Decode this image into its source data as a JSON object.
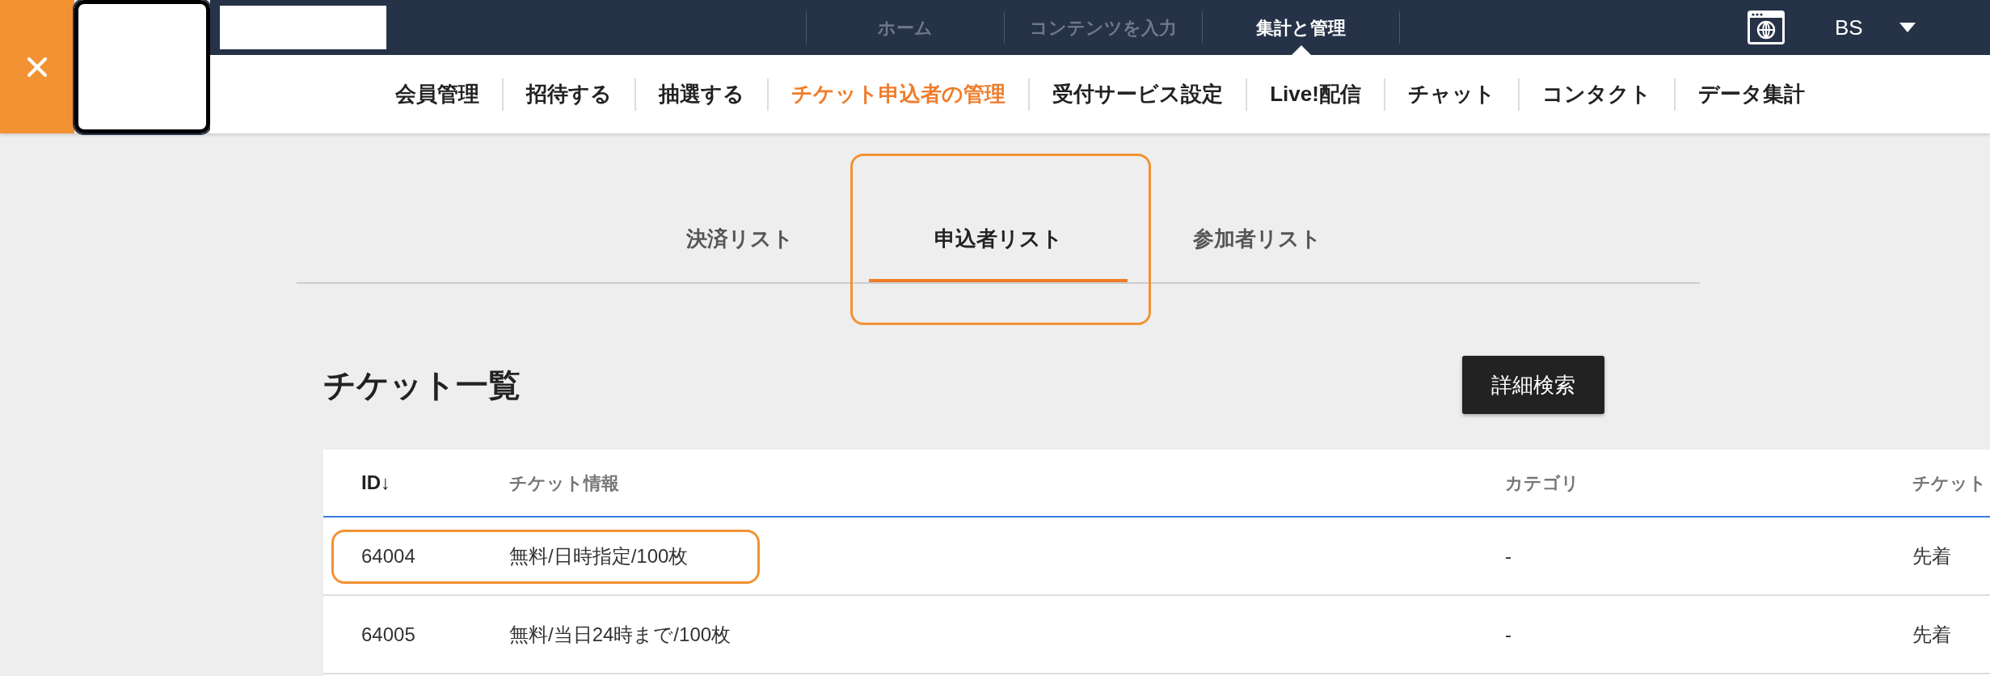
{
  "top_nav": {
    "items": [
      {
        "label": "ホーム",
        "selected": false
      },
      {
        "label": "コンテンツを入力",
        "selected": false
      },
      {
        "label": "集計と管理",
        "selected": true
      }
    ]
  },
  "user": {
    "initials": "BS"
  },
  "main_nav": {
    "items": [
      {
        "label": "会員管理",
        "selected": false
      },
      {
        "label": "招待する",
        "selected": false
      },
      {
        "label": "抽選する",
        "selected": false
      },
      {
        "label": "チケット申込者の管理",
        "selected": true
      },
      {
        "label": "受付サービス設定",
        "selected": false
      },
      {
        "label": "Live!配信",
        "selected": false
      },
      {
        "label": "チャット",
        "selected": false
      },
      {
        "label": "コンタクト",
        "selected": false
      },
      {
        "label": "データ集計",
        "selected": false
      }
    ]
  },
  "tabs": [
    {
      "label": "決済リスト",
      "selected": false,
      "highlighted": false
    },
    {
      "label": "申込者リスト",
      "selected": true,
      "highlighted": true
    },
    {
      "label": "参加者リスト",
      "selected": false,
      "highlighted": false
    }
  ],
  "section": {
    "title": "チケット一覧",
    "search_button": "詳細検索"
  },
  "table": {
    "columns": [
      "ID↓",
      "チケット情報",
      "カテゴリ",
      "チケット"
    ],
    "rows": [
      {
        "cells": [
          "64004",
          "無料/日時指定/100枚",
          "-",
          "先着"
        ],
        "highlighted": true
      },
      {
        "cells": [
          "64005",
          "無料/当日24時まで/100枚",
          "-",
          "先着"
        ],
        "highlighted": false
      }
    ]
  }
}
